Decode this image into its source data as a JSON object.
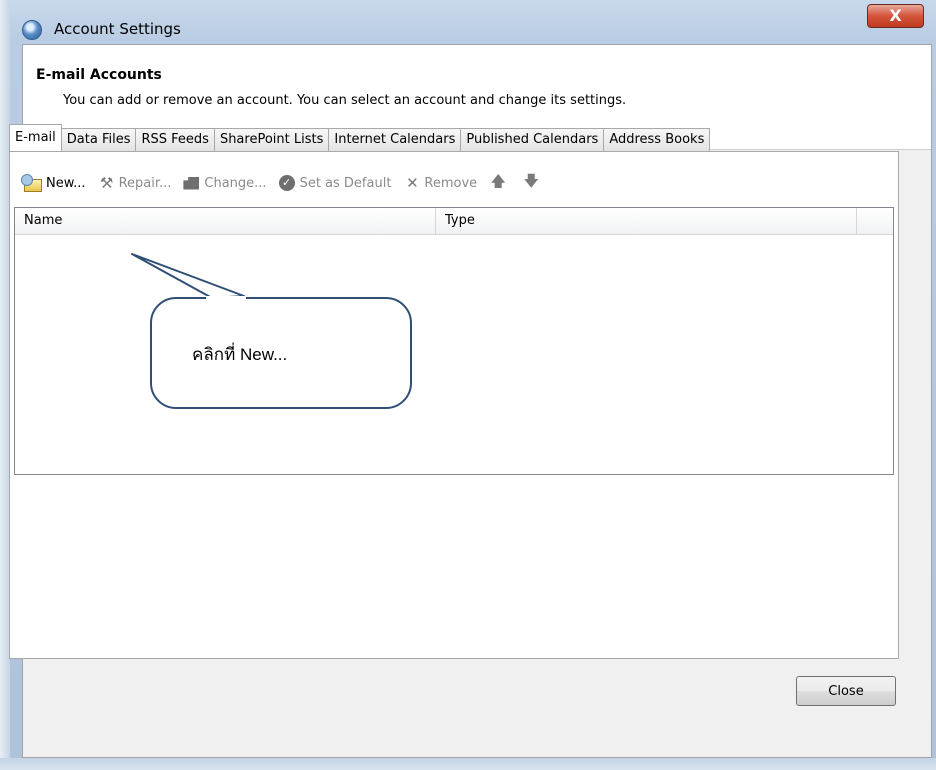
{
  "window": {
    "title": "Account Settings",
    "close_glyph": "X",
    "icon": "outlook-globe-icon"
  },
  "header": {
    "title": "E-mail Accounts",
    "subtitle": "You can add or remove an account. You can select an account and change its settings."
  },
  "tabs": [
    {
      "label": "E-mail",
      "active": true
    },
    {
      "label": "Data Files"
    },
    {
      "label": "RSS Feeds"
    },
    {
      "label": "SharePoint Lists"
    },
    {
      "label": "Internet Calendars"
    },
    {
      "label": "Published Calendars"
    },
    {
      "label": "Address Books"
    }
  ],
  "toolbar": {
    "new_label": "New...",
    "repair_label": "Repair...",
    "change_label": "Change...",
    "default_label": "Set as Default",
    "remove_label": "Remove"
  },
  "list": {
    "columns": [
      "Name",
      "Type"
    ],
    "rows": []
  },
  "callout": {
    "text": "คลิกที่ New..."
  },
  "footer": {
    "close_label": "Close"
  },
  "colors": {
    "callout_border": "#304f76",
    "close_button_red": "#c13a1f"
  }
}
